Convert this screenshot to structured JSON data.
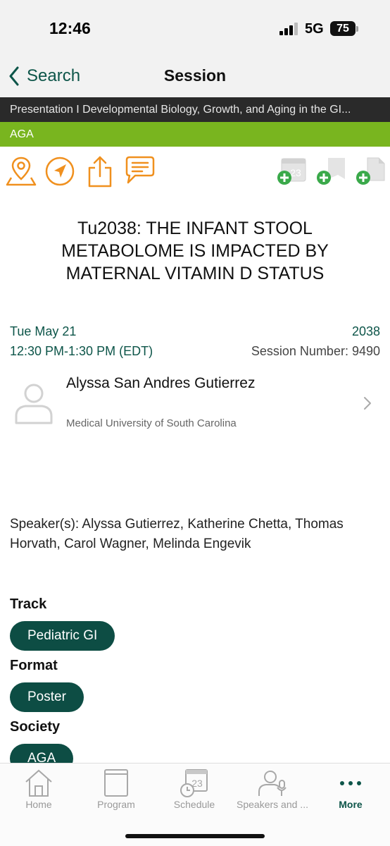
{
  "status": {
    "time": "12:46",
    "network": "5G",
    "battery": "75"
  },
  "nav": {
    "back_label": "Search",
    "title": "Session"
  },
  "category": "Presentation I Developmental Biology, Growth, and Aging in the GI...",
  "society_banner": "AGA",
  "actions": {
    "icons": [
      "map-pin-icon",
      "navigation-icon",
      "share-icon",
      "comment-icon"
    ],
    "add_icons": [
      "add-to-calendar-icon",
      "add-bookmark-icon",
      "add-note-icon"
    ],
    "calendar_day": "23",
    "accent_color": "#f0901e",
    "add_color": "#3aa94a"
  },
  "session": {
    "title": "Tu2038: THE INFANT STOOL METABOLOME IS IMPACTED BY MATERNAL VITAMIN D STATUS",
    "date": "Tue May 21",
    "time": "12:30 PM-1:30 PM (EDT)",
    "code": "2038",
    "session_number": "Session Number: 9490"
  },
  "presenter": {
    "name": "Alyssa San Andres Gutierrez",
    "organization": "Medical University of South Carolina"
  },
  "speakers": "Speaker(s): Alyssa Gutierrez, Katherine Chetta, Thomas Horvath, Carol Wagner, Melinda Engevik",
  "details": {
    "track_label": "Track",
    "track_value": "Pediatric GI",
    "format_label": "Format",
    "format_value": "Poster",
    "society_label": "Society",
    "society_value": "AGA"
  },
  "tabs": [
    {
      "label": "Home",
      "icon": "home-icon"
    },
    {
      "label": "Program",
      "icon": "book-icon"
    },
    {
      "label": "Schedule",
      "icon": "schedule-icon"
    },
    {
      "label": "Speakers and ...",
      "icon": "speaker-icon"
    },
    {
      "label": "More",
      "icon": "more-icon"
    }
  ],
  "brand_color": "#0d5549"
}
